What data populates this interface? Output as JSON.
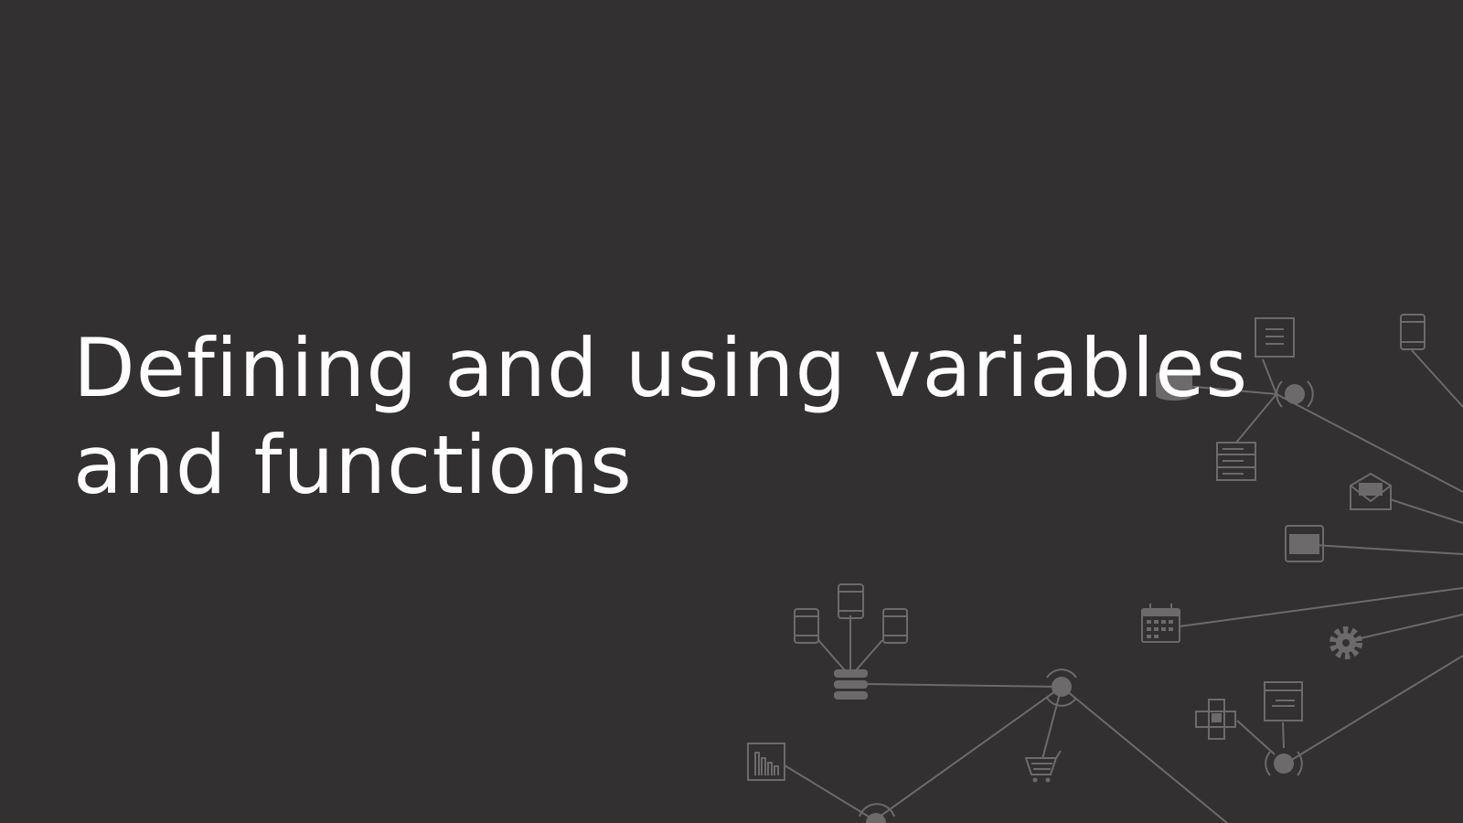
{
  "slide": {
    "title_lines": [
      "Defining and using variables",
      "and functions"
    ],
    "background_color": "#323031",
    "text_color": "#ffffff",
    "graphic_color": "#6c6a6b"
  },
  "network_icons": [
    "document-icon",
    "phone-icon",
    "database-icon",
    "hub-icon",
    "server-icon",
    "mail-icon",
    "tablet-icon",
    "calendar-icon",
    "gear-icon",
    "browser-window-icon",
    "fax-icon",
    "chart-icon",
    "cart-icon",
    "phone-left-icon",
    "phone-center-icon",
    "phone-right-icon",
    "database-stack-icon"
  ]
}
